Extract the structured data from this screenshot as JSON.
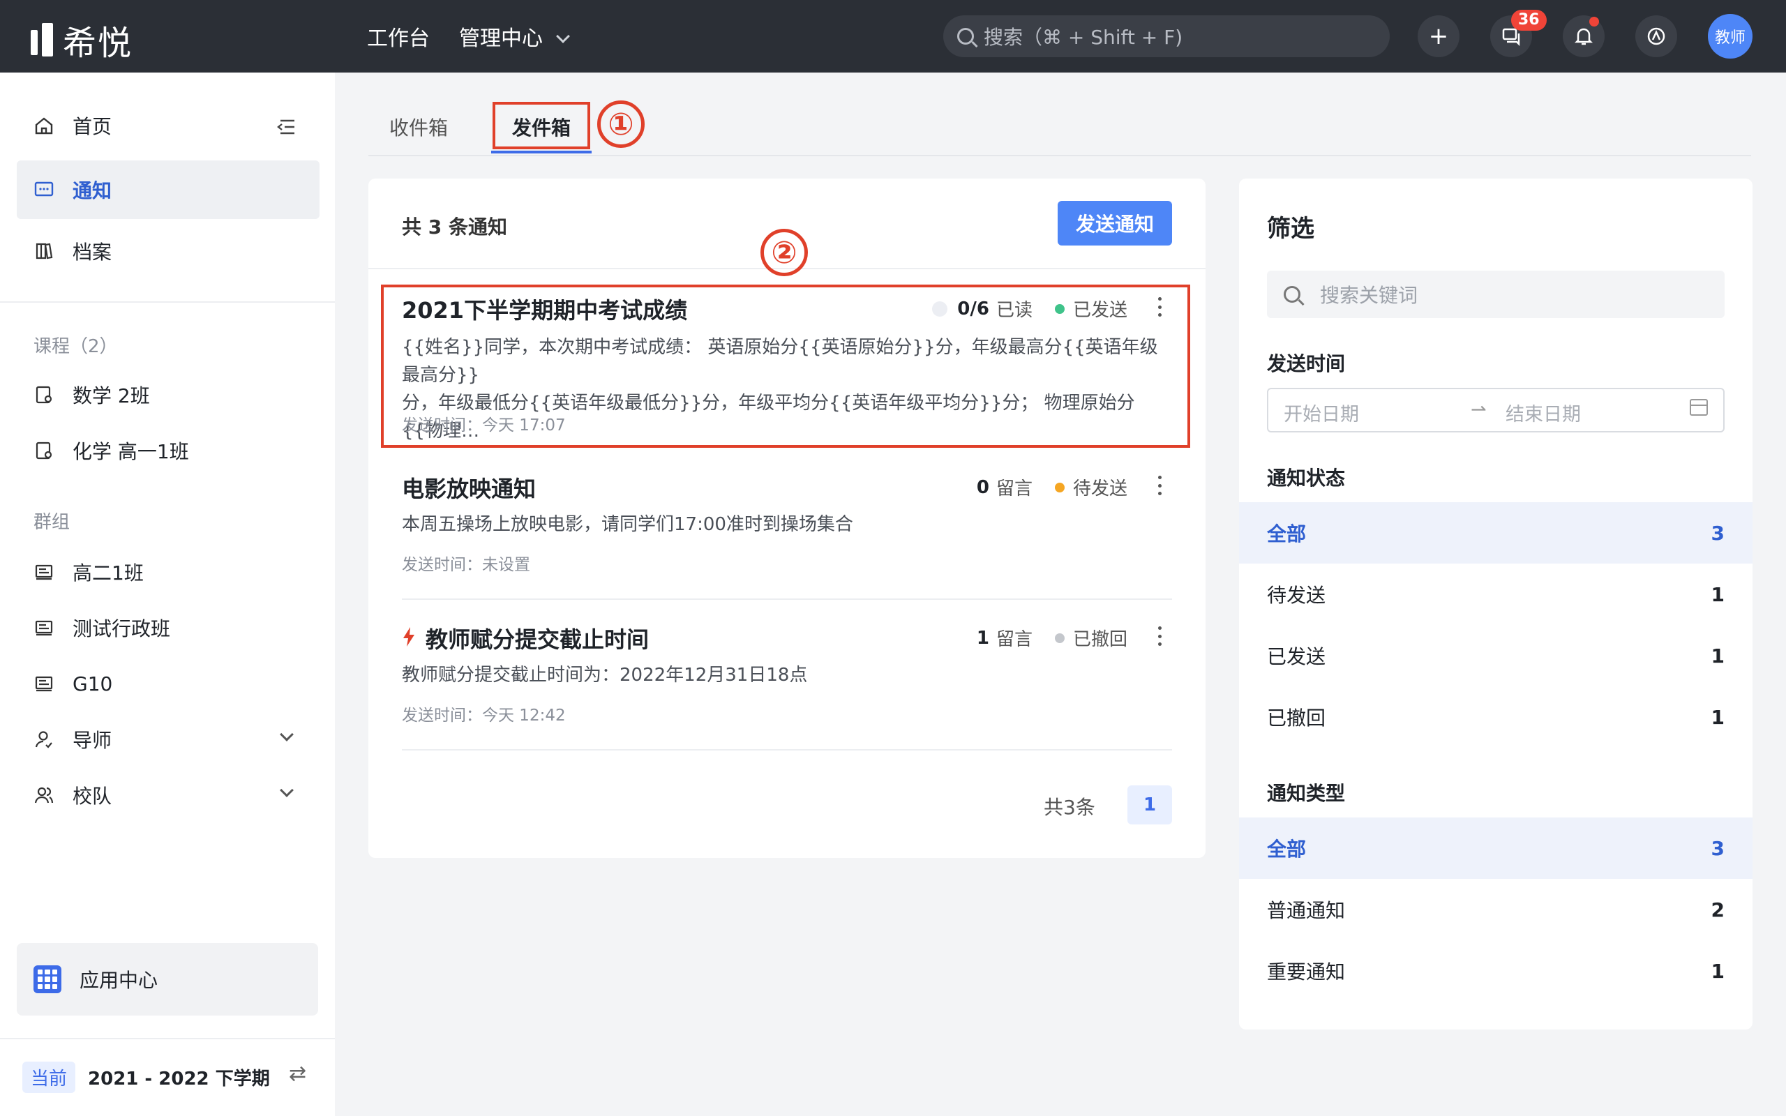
{
  "topbar": {
    "logo": "希悦",
    "nav": [
      "工作台",
      "管理中心"
    ],
    "search_placeholder": "搜索（⌘ + Shift + F)",
    "plus": "+",
    "messages_badge": "36",
    "avatar": "教师"
  },
  "sidebar": {
    "top_items": [
      {
        "label": "首页",
        "icon": "home-icon"
      },
      {
        "label": "通知",
        "icon": "message-icon",
        "active": true
      },
      {
        "label": "档案",
        "icon": "archive-icon"
      }
    ],
    "courses_header": "课程（2）",
    "courses": [
      "数学 2班",
      "化学 高一1班"
    ],
    "groups_header": "群组",
    "groups": [
      "高二1班",
      "测试行政班",
      "G10"
    ],
    "expandables": [
      "导师",
      "校队"
    ],
    "app_center": "应用中心",
    "term_tag": "当前",
    "term": "2021 - 2022 下学期"
  },
  "tabs": {
    "inbox": "收件箱",
    "outbox": "发件箱",
    "annotation_1": "①",
    "annotation_2": "②"
  },
  "main": {
    "count_text": "共 3 条通知",
    "send_button": "发送通知",
    "notices": [
      {
        "title": "2021下半学期期中考试成绩",
        "stat_value": "0/6",
        "stat_label": "已读",
        "status": "已发送",
        "body_line1": "{{姓名}}同学，本次期中考试成绩： 英语原始分{{英语原始分}}分，年级最高分{{英语年级最高分}}",
        "body_line2": "分，年级最低分{{英语年级最低分}}分，年级平均分{{英语年级平均分}}分； 物理原始分{{物理…",
        "time": "发送时间：今天 17:07"
      },
      {
        "title": "电影放映通知",
        "stat_value": "0",
        "stat_label": "留言",
        "status": "待发送",
        "body_line1": "本周五操场上放映电影，请同学们17:00准时到操场集合",
        "time": "发送时间：未设置"
      },
      {
        "title": "教师赋分提交截止时间",
        "stat_value": "1",
        "stat_label": "留言",
        "status": "已撤回",
        "body_line1": "教师赋分提交截止时间为：2022年12月31日18点",
        "time": "发送时间：今天 12:42"
      }
    ],
    "pager_total": "共3条",
    "pager_page": "1"
  },
  "filter": {
    "title": "筛选",
    "search_placeholder": "搜索关键词",
    "send_time_label": "发送时间",
    "start_date": "开始日期",
    "end_date": "结束日期",
    "status_label": "通知状态",
    "status_options": [
      {
        "label": "全部",
        "count": "3"
      },
      {
        "label": "待发送",
        "count": "1"
      },
      {
        "label": "已发送",
        "count": "1"
      },
      {
        "label": "已撤回",
        "count": "1"
      }
    ],
    "type_label": "通知类型",
    "type_options": [
      {
        "label": "全部",
        "count": "3"
      },
      {
        "label": "普通通知",
        "count": "2"
      },
      {
        "label": "重要通知",
        "count": "1"
      }
    ]
  },
  "colors": {
    "accent": "#3d6be8",
    "sent": "#3fc38a",
    "pending": "#f5a623",
    "revoked": "#c4c7cc",
    "annotation": "#e0402a"
  }
}
